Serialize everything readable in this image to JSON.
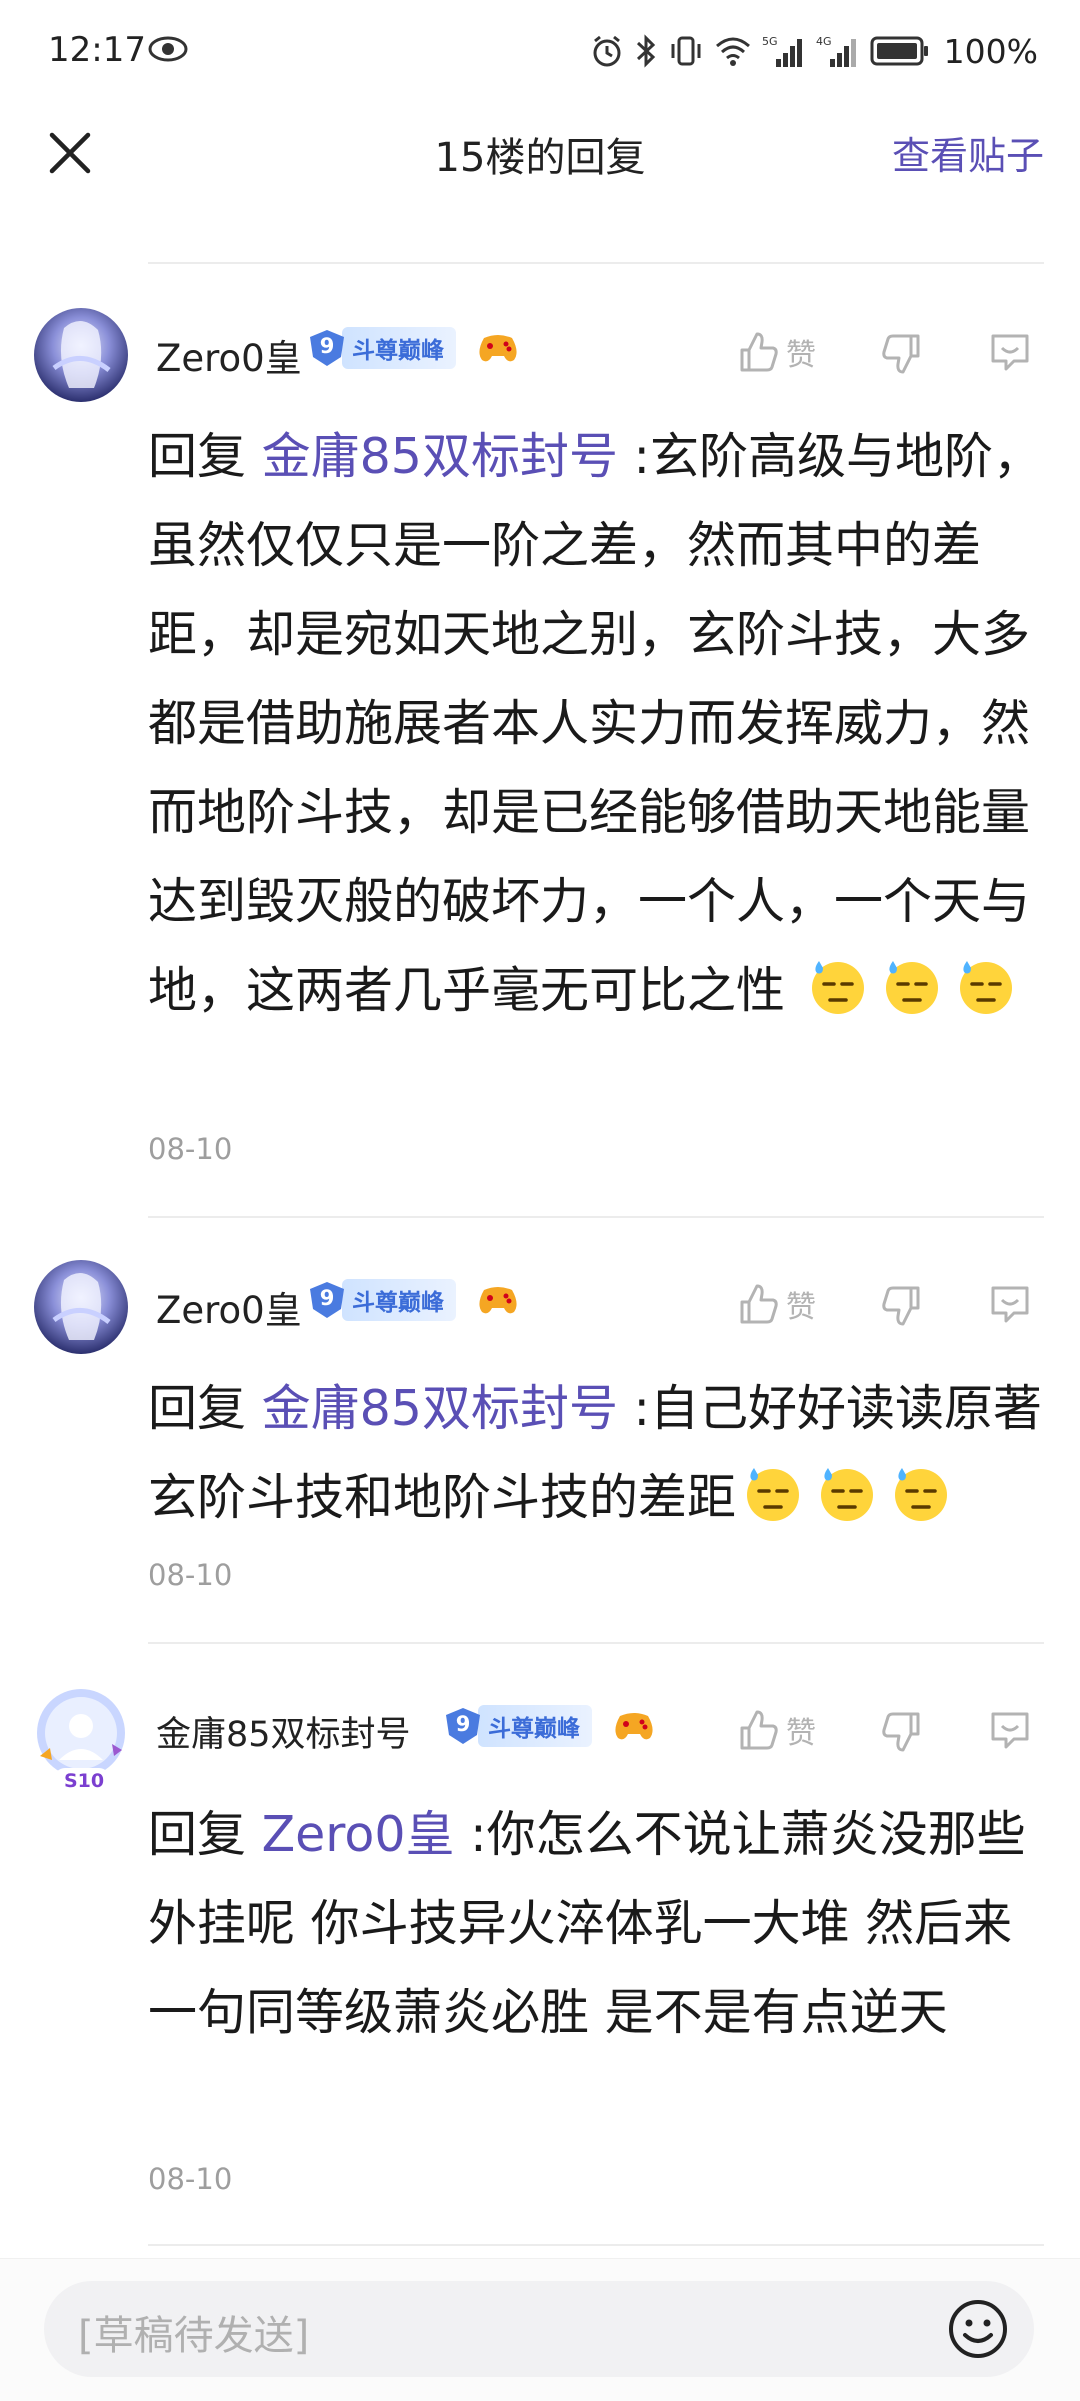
{
  "status_bar": {
    "time": "12:17",
    "battery": "100%",
    "signal_5g": "5G",
    "signal_4g": "4G"
  },
  "header": {
    "title": "15楼的回复",
    "view_post": "查看贴子"
  },
  "comments": [
    {
      "username": "Zero0皇",
      "level": "9",
      "level_title": "斗尊巅峰",
      "like_label": "赞",
      "reply_word": "回复",
      "reply_target": "金庸85双标封号",
      "text": ":玄阶高级与地阶，虽然仅仅只是一阶之差，然而其中的差距，却是宛如天地之别，玄阶斗技，大多都是借助施展者本人实力而发挥威力，然而地阶斗技，却是已经能够借助天地能量达到毁灭般的破坏力，一个人，一个天与地，这两者几乎毫无可比之性",
      "emoji_count": 3,
      "date": "08-10"
    },
    {
      "username": "Zero0皇",
      "level": "9",
      "level_title": "斗尊巅峰",
      "like_label": "赞",
      "reply_word": "回复",
      "reply_target": "金庸85双标封号",
      "text": ":自己好好读读原著玄阶斗技和地阶斗技的差距",
      "emoji_count": 3,
      "date": "08-10"
    },
    {
      "username": "金庸85双标封号",
      "level": "9",
      "level_title": "斗尊巅峰",
      "avatar_badge": "S10",
      "like_label": "赞",
      "reply_word": "回复",
      "reply_target": "Zero0皇",
      "text": ":你怎么不说让萧炎没那些外挂呢 你斗技异火淬体乳一大堆 然后来一句同等级萧炎必胜 是不是有点逆天",
      "emoji_count": 0,
      "date": "08-10"
    }
  ],
  "composer": {
    "placeholder": "[草稿待发送]"
  },
  "colors": {
    "accent": "#5a4fb5",
    "level_badge": "#3b6cd8",
    "muted": "#9e9e9e"
  },
  "icons": [
    "eye-icon",
    "alarm-icon",
    "bluetooth-icon",
    "vibrate-icon",
    "wifi-icon",
    "signal-icon",
    "battery-icon",
    "close-icon",
    "thumbs-up-icon",
    "thumbs-down-icon",
    "comment-icon",
    "game-controller-icon",
    "sweat-emoji",
    "smiley-icon"
  ]
}
